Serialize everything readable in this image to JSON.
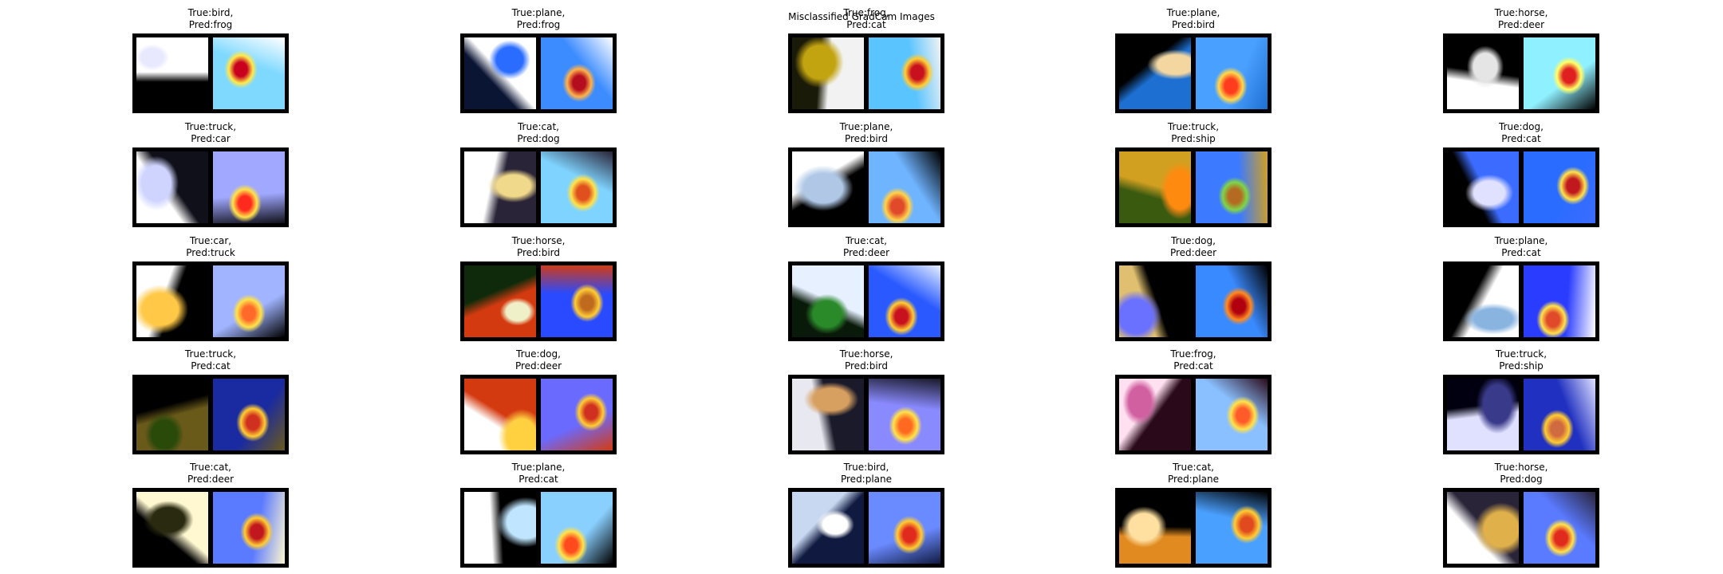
{
  "figure": {
    "title": "Misclassified GradCam Images"
  },
  "palette": {
    "jet": [
      "#00007f",
      "#0000ff",
      "#007fff",
      "#00ffff",
      "#7fff7f",
      "#ffff00",
      "#ff7f00",
      "#ff0000",
      "#7f0000"
    ]
  },
  "items": [
    {
      "true_label": "True:bird,",
      "pred_label": "Pred:frog",
      "orig": {
        "c1": "#000000",
        "c2": "#ffffff",
        "c3": "#e8e8ff"
      },
      "heat": {
        "bg": "#7fd9ff",
        "peak": "#c8001e",
        "mid": "#ffe94a"
      }
    },
    {
      "true_label": "True:plane,",
      "pred_label": "Pred:frog",
      "orig": {
        "c1": "#0a1433",
        "c2": "#ffffff",
        "c3": "#2a6cff"
      },
      "heat": {
        "bg": "#3c8cff",
        "peak": "#b40d1e",
        "mid": "#ffb24a"
      }
    },
    {
      "true_label": "True:frog,",
      "pred_label": "Pred:cat",
      "orig": {
        "c1": "#1a1a08",
        "c2": "#f2f2f2",
        "c3": "#c2a310"
      },
      "heat": {
        "bg": "#5ac4ff",
        "peak": "#c8101e",
        "mid": "#ffcc33"
      }
    },
    {
      "true_label": "True:plane,",
      "pred_label": "Pred:bird",
      "orig": {
        "c1": "#000000",
        "c2": "#1d6fd1",
        "c3": "#f3d6a0"
      },
      "heat": {
        "bg": "#4aa0ff",
        "peak": "#ff3c1e",
        "mid": "#ffd84a"
      }
    },
    {
      "true_label": "True:horse,",
      "pred_label": "Pred:deer",
      "orig": {
        "c1": "#ffffff",
        "c2": "#000000",
        "c3": "#e5e5e5"
      },
      "heat": {
        "bg": "#8ff0ff",
        "peak": "#e02020",
        "mid": "#ffff66"
      }
    },
    {
      "true_label": "True:truck,",
      "pred_label": "Pred:car",
      "orig": {
        "c1": "#ffffff",
        "c2": "#10101a",
        "c3": "#cfd4ff"
      },
      "heat": {
        "bg": "#a0a8ff",
        "peak": "#ff2a1e",
        "mid": "#ffe24a"
      }
    },
    {
      "true_label": "True:cat,",
      "pred_label": "Pred:dog",
      "orig": {
        "c1": "#ffffff",
        "c2": "#2a2438",
        "c3": "#f0d98a"
      },
      "heat": {
        "bg": "#7fd4ff",
        "peak": "#e0501e",
        "mid": "#ffe24a"
      }
    },
    {
      "true_label": "True:plane,",
      "pred_label": "Pred:bird",
      "orig": {
        "c1": "#ffffff",
        "c2": "#000000",
        "c3": "#b0c8e6"
      },
      "heat": {
        "bg": "#6fb4ff",
        "peak": "#e04a2a",
        "mid": "#ffd24a"
      }
    },
    {
      "true_label": "True:truck,",
      "pred_label": "Pred:ship",
      "orig": {
        "c1": "#3a5a10",
        "c2": "#d2a020",
        "c3": "#ff8a10"
      },
      "heat": {
        "bg": "#3c7aff",
        "peak": "#b46a20",
        "mid": "#7fd44a"
      }
    },
    {
      "true_label": "True:dog,",
      "pred_label": "Pred:cat",
      "orig": {
        "c1": "#000000",
        "c2": "#3c6cff",
        "c3": "#e0e0ff"
      },
      "heat": {
        "bg": "#2a6cff",
        "peak": "#c0181e",
        "mid": "#ffe24a"
      }
    },
    {
      "true_label": "True:car,",
      "pred_label": "Pred:truck",
      "orig": {
        "c1": "#ffffff",
        "c2": "#000000",
        "c3": "#ffc846"
      },
      "heat": {
        "bg": "#a0b4ff",
        "peak": "#ff6a2a",
        "mid": "#ffe24a"
      }
    },
    {
      "true_label": "True:horse,",
      "pred_label": "Pred:bird",
      "orig": {
        "c1": "#0e2a0a",
        "c2": "#d43a10",
        "c3": "#f0f0c8"
      },
      "heat": {
        "bg": "#2a4aff",
        "peak": "#c06a20",
        "mid": "#ffcc33"
      }
    },
    {
      "true_label": "True:cat,",
      "pred_label": "Pred:deer",
      "orig": {
        "c1": "#0a1a0a",
        "c2": "#e6f0ff",
        "c3": "#2a8a2a"
      },
      "heat": {
        "bg": "#2a5aff",
        "peak": "#c8101e",
        "mid": "#ffcc33"
      }
    },
    {
      "true_label": "True:dog,",
      "pred_label": "Pred:deer",
      "orig": {
        "c1": "#e0c070",
        "c2": "#000000",
        "c3": "#6a70ff"
      },
      "heat": {
        "bg": "#3a8aff",
        "peak": "#b00010",
        "mid": "#ff8a20"
      }
    },
    {
      "true_label": "True:plane,",
      "pred_label": "Pred:cat",
      "orig": {
        "c1": "#000000",
        "c2": "#ffffff",
        "c3": "#8ab4e0"
      },
      "heat": {
        "bg": "#2a3cff",
        "peak": "#e04a2a",
        "mid": "#ffe24a"
      }
    },
    {
      "true_label": "True:truck,",
      "pred_label": "Pred:cat",
      "orig": {
        "c1": "#000000",
        "c2": "#6a5a1a",
        "c3": "#2a4a0a"
      },
      "heat": {
        "bg": "#1a2aa0",
        "peak": "#d03020",
        "mid": "#ffcc33"
      }
    },
    {
      "true_label": "True:dog,",
      "pred_label": "Pred:deer",
      "orig": {
        "c1": "#ffffff",
        "c2": "#d43a10",
        "c3": "#ffd040"
      },
      "heat": {
        "bg": "#6a6aff",
        "peak": "#d03020",
        "mid": "#ffcc33"
      }
    },
    {
      "true_label": "True:horse,",
      "pred_label": "Pred:bird",
      "orig": {
        "c1": "#e8e8f0",
        "c2": "#1a1a2a",
        "c3": "#d8a060"
      },
      "heat": {
        "bg": "#8a8aff",
        "peak": "#ff6a20",
        "mid": "#ffe24a"
      }
    },
    {
      "true_label": "True:frog,",
      "pred_label": "Pred:cat",
      "orig": {
        "c1": "#ffe0f0",
        "c2": "#2a0a1a",
        "c3": "#d060a0"
      },
      "heat": {
        "bg": "#8ac0ff",
        "peak": "#ff5a2a",
        "mid": "#ffe24a"
      }
    },
    {
      "true_label": "True:truck,",
      "pred_label": "Pred:ship",
      "orig": {
        "c1": "#000010",
        "c2": "#e0e0ff",
        "c3": "#3a3a8a"
      },
      "heat": {
        "bg": "#2030c0",
        "peak": "#d06a40",
        "mid": "#ffcc33"
      }
    },
    {
      "true_label": "True:cat,",
      "pred_label": "Pred:deer",
      "orig": {
        "c1": "#000000",
        "c2": "#fff8d0",
        "c3": "#2a2a10"
      },
      "heat": {
        "bg": "#5a7aff",
        "peak": "#c0181e",
        "mid": "#ffcc33"
      }
    },
    {
      "true_label": "True:plane,",
      "pred_label": "Pred:cat",
      "orig": {
        "c1": "#ffffff",
        "c2": "#000000",
        "c3": "#c0e6ff"
      },
      "heat": {
        "bg": "#8ad0ff",
        "peak": "#ff4a1e",
        "mid": "#ffe24a"
      }
    },
    {
      "true_label": "True:bird,",
      "pred_label": "Pred:plane",
      "orig": {
        "c1": "#c8d8f0",
        "c2": "#101a40",
        "c3": "#ffffff"
      },
      "heat": {
        "bg": "#6a8aff",
        "peak": "#e02a1e",
        "mid": "#ffcc33"
      }
    },
    {
      "true_label": "True:cat,",
      "pred_label": "Pred:plane",
      "orig": {
        "c1": "#e08a20",
        "c2": "#000000",
        "c3": "#ffe0a0"
      },
      "heat": {
        "bg": "#4aa0ff",
        "peak": "#e04a1e",
        "mid": "#ffcc33"
      }
    },
    {
      "true_label": "True:horse,",
      "pred_label": "Pred:dog",
      "orig": {
        "c1": "#ffffff",
        "c2": "#2a2438",
        "c3": "#e0b04a"
      },
      "heat": {
        "bg": "#5a7aff",
        "peak": "#e02a1e",
        "mid": "#ffe24a"
      }
    }
  ]
}
